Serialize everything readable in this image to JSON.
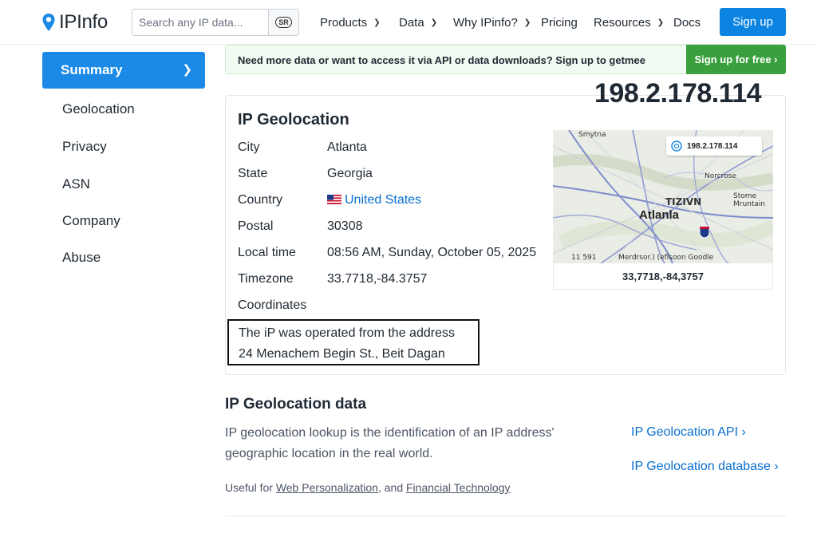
{
  "header": {
    "logo_text": "IPInfo",
    "search_placeholder": "Search any IP data...",
    "search_button": "SR",
    "nav": [
      {
        "label": "Products",
        "dropdown": true
      },
      {
        "label": "Data",
        "dropdown": true
      },
      {
        "label": "Why IPinfo?",
        "dropdown": true
      },
      {
        "label": "Pricing",
        "dropdown": false
      },
      {
        "label": "Resources",
        "dropdown": true
      },
      {
        "label": "Docs",
        "dropdown": false
      }
    ],
    "signup_label": "Sign up"
  },
  "sidebar": {
    "active": "Summary",
    "items": [
      "Geolocation",
      "Privacy",
      "ASN",
      "Company",
      "Abuse"
    ]
  },
  "banner": {
    "text": "Need more data or want to access it via API or data downloads? Sign up to getmee",
    "button": "Sign up for free ›"
  },
  "ip_address": "198.2.178.114",
  "geolocation": {
    "title": "IP Geolocation",
    "rows": [
      {
        "label": "City",
        "value": "Atlanta"
      },
      {
        "label": "State",
        "value": "Georgia"
      },
      {
        "label": "Country",
        "value": "United States"
      },
      {
        "label": "Postal",
        "value": "30308"
      },
      {
        "label": "Local time",
        "value": "08:56 AM, Sunday, October 05, 2025"
      },
      {
        "label": "Timezone",
        "value": "33.7718,-84.3757"
      },
      {
        "label": "Coordinates",
        "value": ""
      }
    ],
    "address_note_line1": "The iP was operated from the address",
    "address_note_line2": "24 Menachem Begin St., Beit Dagan"
  },
  "map": {
    "pill_ip": "198.2.178.114",
    "labels": {
      "smytna": "Smytna",
      "norcrose": "Norcrose",
      "tizivn": "TIZIVN",
      "atlanta": "Atlanla",
      "stone_1": "Stome",
      "stone_2": "Mruntain",
      "scale": "11 591",
      "attribution": "Merdrsor.) (eflsoon Goodle"
    },
    "caption": "33,7718,-84,3757"
  },
  "data_section": {
    "title": "IP Geolocation data",
    "desc": "IP geolocation lookup is the identification of an IP address' geographic location in the real world.",
    "useful_prefix": "Useful for ",
    "useful_link1": "Web Personalization",
    "useful_mid": ", and ",
    "useful_link2": "Financial Technology",
    "links": [
      "IP Geolocation API ›",
      "IP Geolocation database ›"
    ]
  },
  "colors": {
    "brand_blue": "#0a84e0",
    "sidebar_active": "#1a8ae6",
    "banner_green": "#3aa03d",
    "link": "#0a6fd0"
  }
}
